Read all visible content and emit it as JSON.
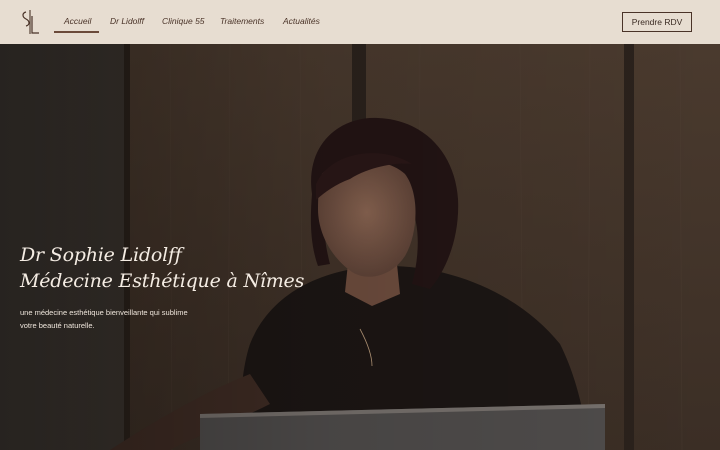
{
  "brand": {
    "logo_letters": "SL"
  },
  "nav": {
    "items": [
      {
        "label": "Accueil",
        "active": true
      },
      {
        "label": "Dr Lidolff",
        "active": false
      },
      {
        "label": "Clinique 55",
        "active": false
      },
      {
        "label": "Traitements",
        "active": false
      },
      {
        "label": "Actualités",
        "active": false
      }
    ],
    "cta_label": "Prendre RDV"
  },
  "hero": {
    "title_line1": "Dr Sophie Lidolff",
    "title_line2": "Médecine Esthétique à Nîmes",
    "subtitle_line1": "une médecine esthétique bienveillante qui sublime",
    "subtitle_line2": "votre beauté naturelle."
  },
  "colors": {
    "nav_bg": "#e7ddd1",
    "nav_text": "#4a3328",
    "accent": "#6b4a3a",
    "hero_text": "#f4ece3"
  }
}
